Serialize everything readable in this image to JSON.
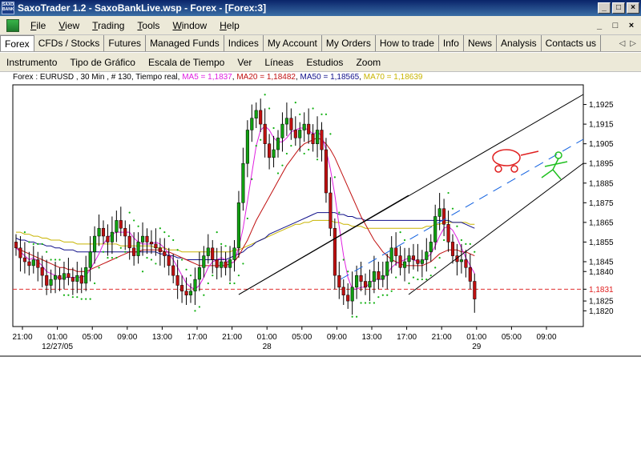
{
  "window": {
    "title": "SaxoTrader 1.2 - SaxoBankLive.wsp - Forex - [Forex:3]",
    "logo_text": "SAXO BANK",
    "controls": [
      "_",
      "□",
      "×"
    ]
  },
  "menu": {
    "items": [
      {
        "label": "File",
        "accel": "F",
        "rest": "ile"
      },
      {
        "label": "View",
        "accel": "V",
        "rest": "iew"
      },
      {
        "label": "Trading",
        "accel": "T",
        "rest": "rading"
      },
      {
        "label": "Tools",
        "accel": "T",
        "rest": "ools"
      },
      {
        "label": "Window",
        "accel": "W",
        "rest": "indow"
      },
      {
        "label": "Help",
        "accel": "H",
        "rest": "elp"
      }
    ],
    "mdi_controls": [
      "_",
      "□",
      "×"
    ]
  },
  "tabs": [
    {
      "label": "Forex",
      "active": true
    },
    {
      "label": "CFDs / Stocks"
    },
    {
      "label": "Futures"
    },
    {
      "label": "Managed Funds"
    },
    {
      "label": "Indices"
    },
    {
      "label": "My Account"
    },
    {
      "label": "My Orders"
    },
    {
      "label": "How to trade"
    },
    {
      "label": "Info"
    },
    {
      "label": "News"
    },
    {
      "label": "Analysis"
    },
    {
      "label": "Contacts us"
    }
  ],
  "tab_scroll": {
    "left": "◁",
    "right": "▷"
  },
  "chart_toolbar": [
    "Instrumento",
    "Tipo de Gráfico",
    "Escala de Tiempo",
    "Ver",
    "Líneas",
    "Estudios",
    "Zoom"
  ],
  "info": {
    "instrument": "Forex : EURUSD , 30 Min , # 130, Tiempo real",
    "ma5": "MA5 = 1,1837",
    "ma20": "MA20 = 1,18482",
    "ma50": "MA50 = 1,18565",
    "ma70": "MA70 = 1,18639",
    "colors": {
      "ma5": "#e020e0",
      "ma20": "#c01010",
      "ma50": "#10108a",
      "ma70": "#c8b400"
    }
  },
  "chart_data": {
    "type": "candlestick",
    "instrument": "EURUSD",
    "interval": "30 Min",
    "ylim": [
      1.1812,
      1.1935
    ],
    "y_ticks": [
      "1,1925",
      "1,1915",
      "1,1905",
      "1,1895",
      "1,1885",
      "1,1875",
      "1,1865",
      "1,1855",
      "1,1845",
      "1,1840",
      "1,1831",
      "1,1825",
      "1,1820"
    ],
    "current_price": "1,1831",
    "current_price_value": 1.1831,
    "x_ticks": [
      "21:00",
      "01:00",
      "05:00",
      "09:00",
      "13:00",
      "17:00",
      "21:00",
      "01:00",
      "05:00",
      "09:00",
      "13:00",
      "17:00",
      "21:00",
      "01:00",
      "05:00",
      "09:00"
    ],
    "date_labels": [
      {
        "label": "12/27/05",
        "tick_index": 1
      },
      {
        "label": "28",
        "tick_index": 7
      },
      {
        "label": "29",
        "tick_index": 13
      }
    ],
    "bars_per_tick": 8,
    "closes": [
      1.1852,
      1.1847,
      1.1845,
      1.1843,
      1.1846,
      1.1842,
      1.1838,
      1.1833,
      1.1836,
      1.1838,
      1.1836,
      1.1839,
      1.1837,
      1.1835,
      1.1838,
      1.1834,
      1.1842,
      1.185,
      1.1858,
      1.1862,
      1.1858,
      1.1855,
      1.186,
      1.1866,
      1.1862,
      1.1858,
      1.1852,
      1.1848,
      1.1855,
      1.1858,
      1.1855,
      1.1854,
      1.1852,
      1.185,
      1.1848,
      1.1843,
      1.1838,
      1.1833,
      1.183,
      1.1828,
      1.183,
      1.1836,
      1.1842,
      1.1848,
      1.1852,
      1.1846,
      1.1842,
      1.1845,
      1.1842,
      1.1846,
      1.1852,
      1.1875,
      1.1895,
      1.1912,
      1.1918,
      1.1922,
      1.1915,
      1.1905,
      1.1898,
      1.1902,
      1.1908,
      1.1915,
      1.1918,
      1.1912,
      1.1908,
      1.1912,
      1.1915,
      1.191,
      1.1905,
      1.1912,
      1.1902,
      1.188,
      1.1862,
      1.1838,
      1.1832,
      1.1828,
      1.1825,
      1.1832,
      1.1838,
      1.1835,
      1.1832,
      1.1835,
      1.184,
      1.1836,
      1.1838,
      1.1845,
      1.1852,
      1.1848,
      1.1842,
      1.1845,
      1.1848,
      1.1846,
      1.1844,
      1.1846,
      1.185,
      1.1855,
      1.1868,
      1.1872,
      1.1864,
      1.1855,
      1.1848,
      1.1845,
      1.1846,
      1.1842,
      1.1835,
      1.1826
    ],
    "ma5": [
      1.1852,
      1.185,
      1.1848,
      1.1846,
      1.1847,
      1.1845,
      1.1843,
      1.184,
      1.1839,
      1.1838,
      1.1836,
      1.1837,
      1.1837,
      1.1837,
      1.1837,
      1.1837,
      1.1838,
      1.1841,
      1.1845,
      1.1849,
      1.1854,
      1.1857,
      1.1859,
      1.186,
      1.186,
      1.186,
      1.186,
      1.1857,
      1.1855,
      1.1854,
      1.1854,
      1.1854,
      1.1855,
      1.1854,
      1.1852,
      1.1849,
      1.1846,
      1.1842,
      1.1838,
      1.1834,
      1.1832,
      1.1831,
      1.1833,
      1.1837,
      1.1842,
      1.1845,
      1.1846,
      1.1847,
      1.1846,
      1.1844,
      1.1845,
      1.1852,
      1.1862,
      1.1876,
      1.189,
      1.1904,
      1.1912,
      1.1914,
      1.1912,
      1.1908,
      1.1906,
      1.1906,
      1.1908,
      1.1911,
      1.1912,
      1.1913,
      1.1913,
      1.1912,
      1.191,
      1.1911,
      1.1909,
      1.1902,
      1.1892,
      1.1879,
      1.1863,
      1.1848,
      1.1837,
      1.1831,
      1.1831,
      1.1832,
      1.1832,
      1.1834,
      1.1836,
      1.1836,
      1.1836,
      1.1839,
      1.1842,
      1.1844,
      1.1845,
      1.1846,
      1.1847,
      1.1846,
      1.1845,
      1.1845,
      1.1847,
      1.1849,
      1.1853,
      1.1858,
      1.1862,
      1.1863,
      1.1861,
      1.1857,
      1.1852,
      1.1847,
      1.1843,
      1.1839
    ],
    "ma20": [
      1.1852,
      1.1851,
      1.185,
      1.1849,
      1.1848,
      1.1847,
      1.1846,
      1.1845,
      1.1844,
      1.1843,
      1.1842,
      1.1842,
      1.1841,
      1.1841,
      1.184,
      1.184,
      1.184,
      1.1841,
      1.1842,
      1.1843,
      1.1844,
      1.1845,
      1.1846,
      1.1847,
      1.1848,
      1.1849,
      1.185,
      1.185,
      1.185,
      1.1851,
      1.1851,
      1.1851,
      1.1851,
      1.1851,
      1.185,
      1.185,
      1.1849,
      1.1848,
      1.1847,
      1.1846,
      1.1845,
      1.1844,
      1.1843,
      1.1843,
      1.1843,
      1.1843,
      1.1843,
      1.1843,
      1.1843,
      1.1844,
      1.1845,
      1.1848,
      1.1852,
      1.1856,
      1.1861,
      1.1866,
      1.187,
      1.1874,
      1.1878,
      1.1882,
      1.1886,
      1.189,
      1.1894,
      1.1897,
      1.19,
      1.1903,
      1.1905,
      1.1906,
      1.1907,
      1.1908,
      1.1907,
      1.1905,
      1.1902,
      1.1898,
      1.1893,
      1.1888,
      1.1883,
      1.1878,
      1.1873,
      1.1868,
      1.1864,
      1.186,
      1.1856,
      1.1853,
      1.185,
      1.1848,
      1.1846,
      1.1845,
      1.1844,
      1.1843,
      1.1843,
      1.1843,
      1.1843,
      1.1843,
      1.1844,
      1.1845,
      1.1847,
      1.1849,
      1.185,
      1.1851,
      1.1851,
      1.1851,
      1.185,
      1.185,
      1.1849,
      1.1848
    ],
    "ma50": [
      1.1857,
      1.1856,
      1.1856,
      1.1855,
      1.1855,
      1.1854,
      1.1854,
      1.1853,
      1.1853,
      1.1852,
      1.1852,
      1.1851,
      1.1851,
      1.1851,
      1.185,
      1.185,
      1.185,
      1.185,
      1.185,
      1.185,
      1.185,
      1.185,
      1.185,
      1.185,
      1.185,
      1.185,
      1.185,
      1.185,
      1.185,
      1.185,
      1.185,
      1.185,
      1.185,
      1.1849,
      1.1849,
      1.1848,
      1.1848,
      1.1847,
      1.1847,
      1.1846,
      1.1846,
      1.1846,
      1.1846,
      1.1846,
      1.1846,
      1.1846,
      1.1846,
      1.1846,
      1.1846,
      1.1847,
      1.1848,
      1.1849,
      1.185,
      1.1852,
      1.1853,
      1.1855,
      1.1856,
      1.1857,
      1.1859,
      1.186,
      1.1861,
      1.1862,
      1.1863,
      1.1864,
      1.1865,
      1.1866,
      1.1867,
      1.1868,
      1.1869,
      1.187,
      1.187,
      1.187,
      1.187,
      1.187,
      1.1869,
      1.1869,
      1.1868,
      1.1868,
      1.1867,
      1.1867,
      1.1866,
      1.1866,
      1.1866,
      1.1866,
      1.1866,
      1.1866,
      1.1866,
      1.1866,
      1.1866,
      1.1866,
      1.1866,
      1.1866,
      1.1866,
      1.1866,
      1.1866,
      1.1866,
      1.1866,
      1.1866,
      1.1866,
      1.1866,
      1.1865,
      1.1865,
      1.1865,
      1.1864,
      1.1863,
      1.1862
    ],
    "ma70": [
      1.186,
      1.186,
      1.1859,
      1.1859,
      1.1858,
      1.1858,
      1.1857,
      1.1857,
      1.1856,
      1.1856,
      1.1856,
      1.1855,
      1.1855,
      1.1855,
      1.1854,
      1.1854,
      1.1854,
      1.1854,
      1.1854,
      1.1854,
      1.1854,
      1.1854,
      1.1854,
      1.1854,
      1.1853,
      1.1853,
      1.1853,
      1.1853,
      1.1853,
      1.1853,
      1.1853,
      1.1853,
      1.1852,
      1.1852,
      1.1852,
      1.1851,
      1.1851,
      1.1851,
      1.185,
      1.185,
      1.185,
      1.185,
      1.185,
      1.185,
      1.185,
      1.185,
      1.185,
      1.185,
      1.185,
      1.185,
      1.1851,
      1.1851,
      1.1852,
      1.1853,
      1.1854,
      1.1855,
      1.1856,
      1.1857,
      1.1858,
      1.1859,
      1.186,
      1.1861,
      1.1862,
      1.1863,
      1.1864,
      1.1864,
      1.1865,
      1.1865,
      1.1866,
      1.1866,
      1.1866,
      1.1866,
      1.1866,
      1.1865,
      1.1865,
      1.1864,
      1.1864,
      1.1863,
      1.1863,
      1.1863,
      1.1862,
      1.1862,
      1.1862,
      1.1862,
      1.1862,
      1.1862,
      1.1862,
      1.1862,
      1.1862,
      1.1862,
      1.1862,
      1.1862,
      1.1862,
      1.1862,
      1.1863,
      1.1863,
      1.1864,
      1.1864,
      1.1865,
      1.1865,
      1.1865,
      1.1865,
      1.1865,
      1.1865,
      1.1864,
      1.1864
    ],
    "colors": {
      "bull": "#10a010",
      "bear": "#c01010",
      "sar": "#10b010",
      "current_line": "#e03030"
    }
  }
}
